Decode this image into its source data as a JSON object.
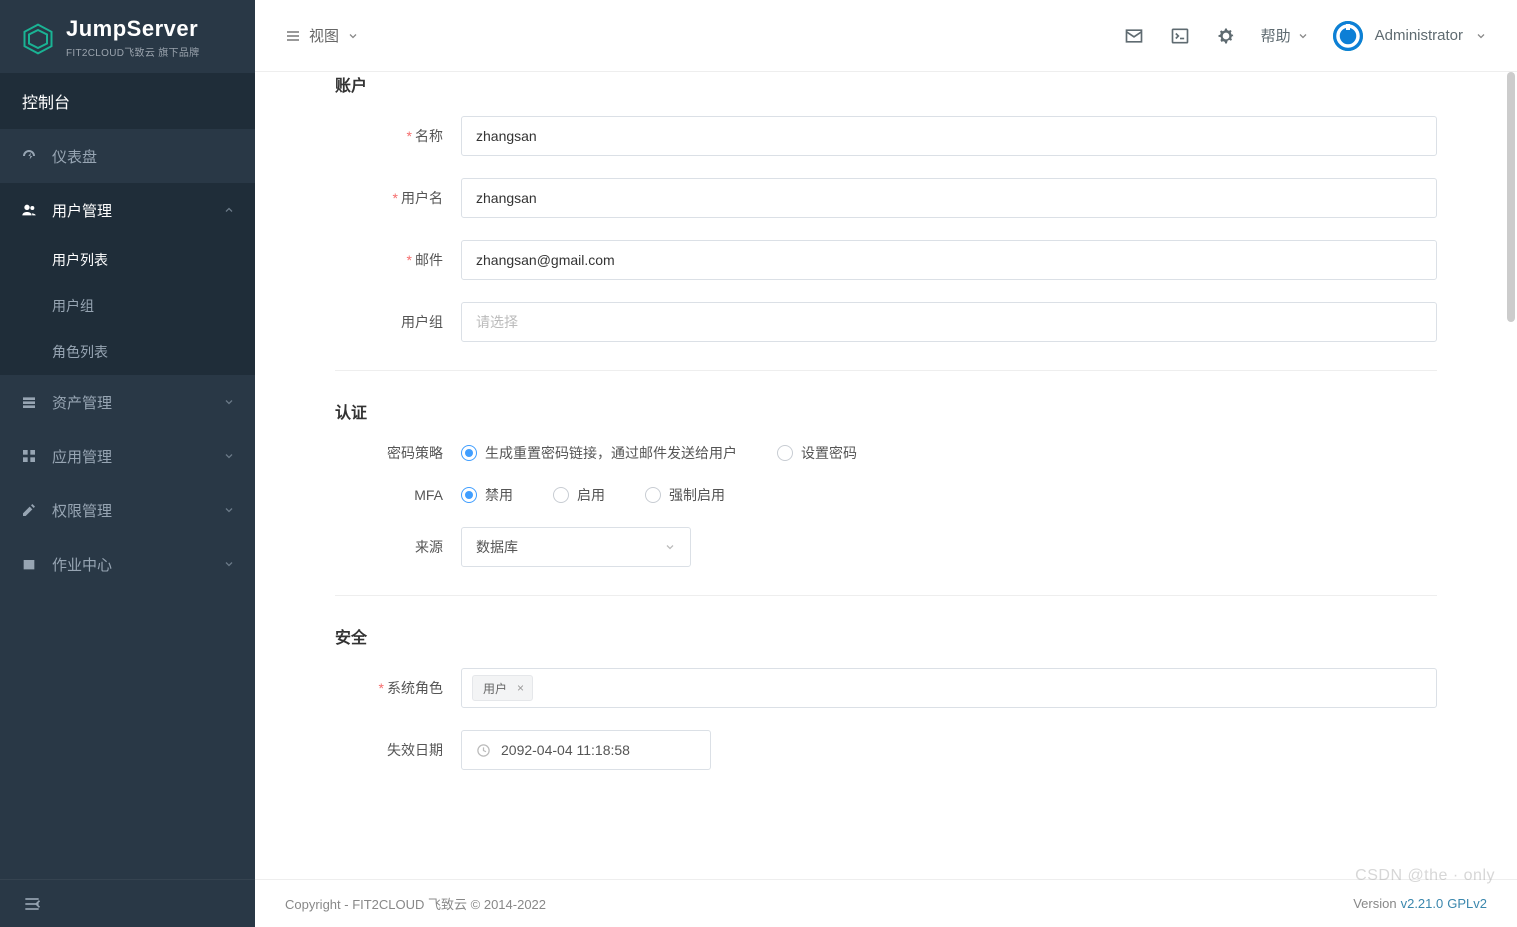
{
  "brand": {
    "title": "JumpServer",
    "subtitle": "FIT2CLOUD飞致云 旗下品牌"
  },
  "console_label": "控制台",
  "sidebar": {
    "items": [
      {
        "label": "仪表盘"
      },
      {
        "label": "用户管理"
      },
      {
        "label": "资产管理"
      },
      {
        "label": "应用管理"
      },
      {
        "label": "权限管理"
      },
      {
        "label": "作业中心"
      }
    ],
    "sub_user": [
      {
        "label": "用户列表"
      },
      {
        "label": "用户组"
      },
      {
        "label": "角色列表"
      }
    ]
  },
  "topbar": {
    "view_label": "视图",
    "help_label": "帮助",
    "user_name": "Administrator"
  },
  "form": {
    "sections": {
      "account": "账户",
      "auth": "认证",
      "security": "安全"
    },
    "labels": {
      "name": "名称",
      "username": "用户名",
      "email": "邮件",
      "usergroup": "用户组",
      "password_policy": "密码策略",
      "mfa": "MFA",
      "source": "来源",
      "system_role": "系统角色",
      "expire_date": "失效日期"
    },
    "values": {
      "name": "zhangsan",
      "username": "zhangsan",
      "email": "zhangsan@gmail.com",
      "usergroup_placeholder": "请选择",
      "source": "数据库",
      "system_role_tag": "用户",
      "expire_date": "2092-04-04 11:18:58"
    },
    "radios": {
      "pwd1": "生成重置密码链接，通过邮件发送给用户",
      "pwd2": "设置密码",
      "mfa1": "禁用",
      "mfa2": "启用",
      "mfa3": "强制启用"
    }
  },
  "footer": {
    "copyright": "Copyright - FIT2CLOUD 飞致云 © 2014-2022",
    "version_prefix": "Version ",
    "version": "v2.21.0",
    "license": " GPLv2"
  },
  "watermark": "CSDN @the · only"
}
